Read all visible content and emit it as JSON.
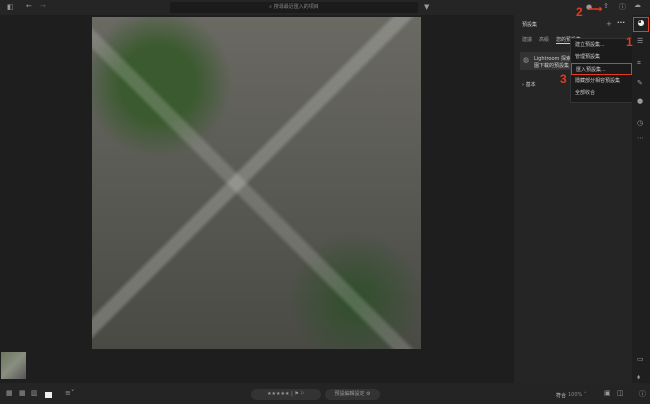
{
  "topbar": {
    "search_placeholder": "搜尋最近匯入的項目"
  },
  "panel": {
    "title": "預設集",
    "tabs": [
      "建議",
      "高級",
      "您的預設集"
    ],
    "notice": "Lightroom 探索到...",
    "notice2": "園下載的預設集",
    "section": "基本"
  },
  "menu": {
    "items": [
      "建立預設集...",
      "管理預設集",
      "匯入預設集...",
      "隱藏部分相容預設集",
      "全部收合"
    ],
    "highlighted_index": 2
  },
  "annotations": {
    "step1": "1",
    "step2": "2",
    "step3": "3",
    "color": "#e53a1f"
  },
  "bottombar": {
    "stars": "★★★★★",
    "flags": "⚑ ⚐",
    "reset_label": "預設編輯設定",
    "fit_label": "符合",
    "zoom": "100%"
  }
}
